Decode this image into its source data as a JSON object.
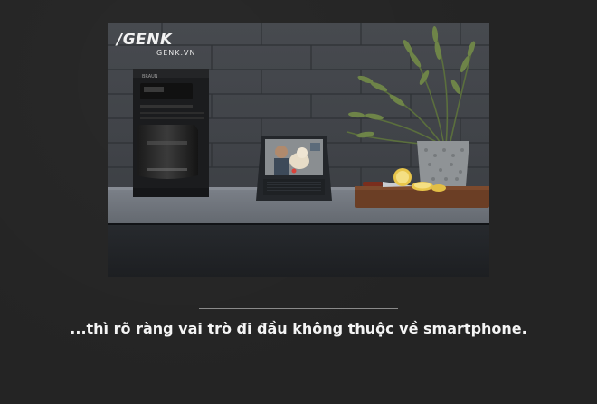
{
  "photo": {
    "logo_mark": "/GENK",
    "logo_sub": "GENK.VN",
    "appliance_brand": "BRAUN"
  },
  "caption": {
    "text": "...thì rõ ràng vai trò đi đầu không thuộc về smartphone."
  }
}
